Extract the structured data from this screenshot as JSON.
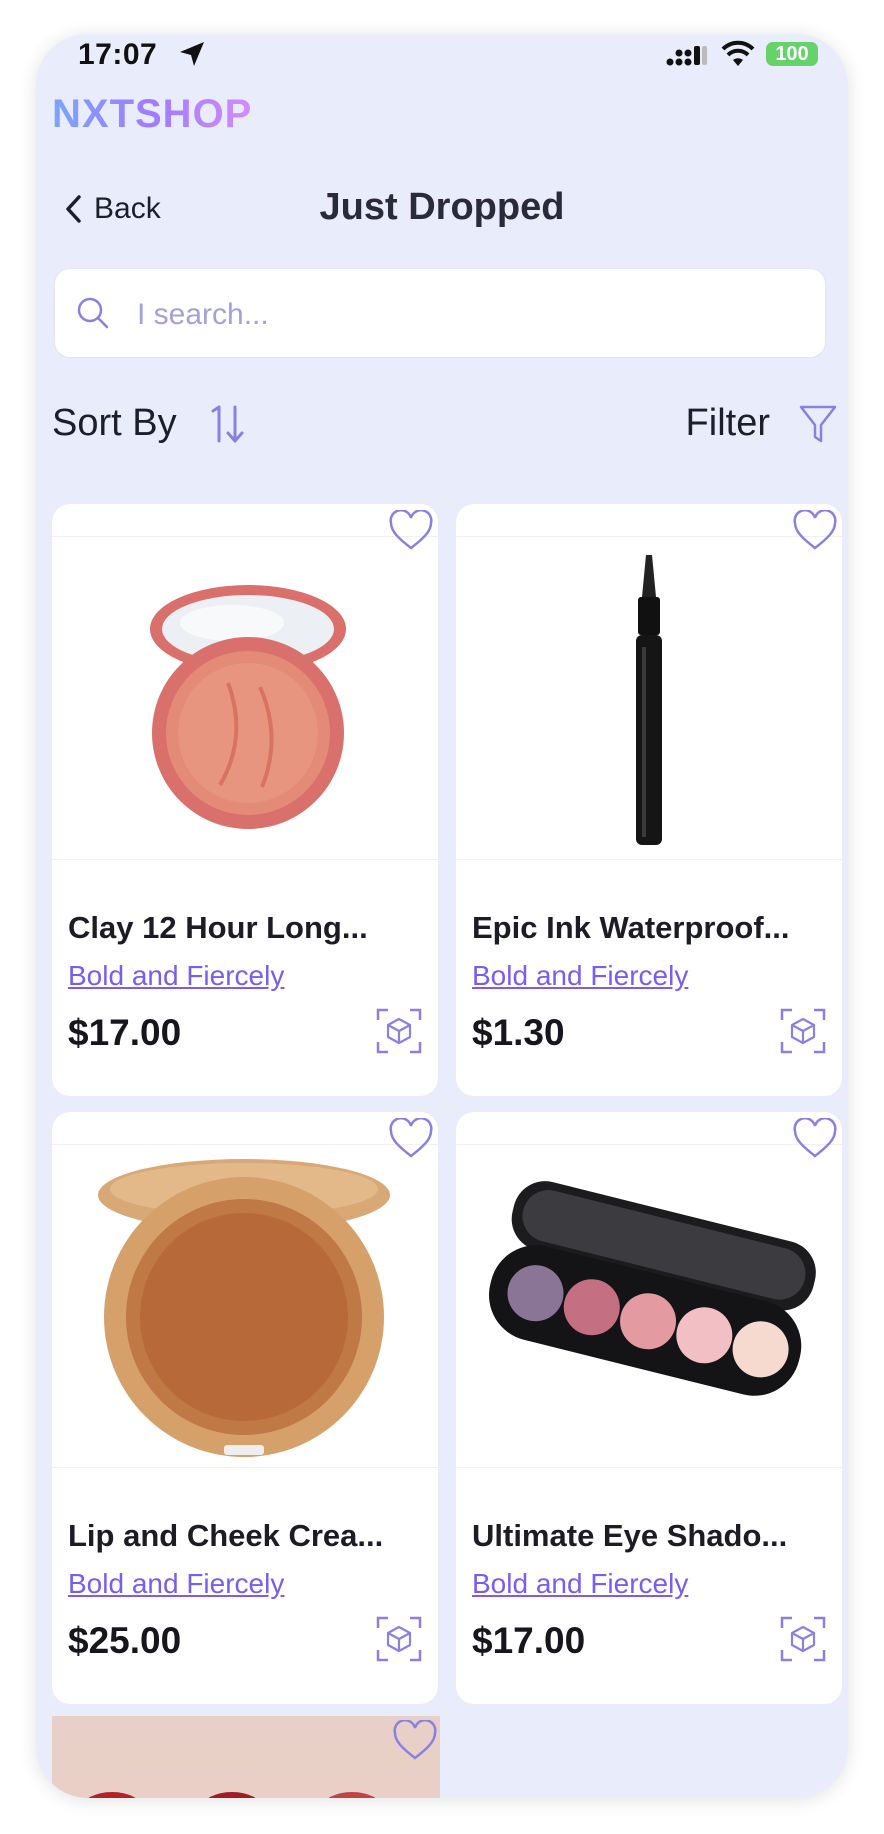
{
  "status": {
    "time": "17:07",
    "battery": "100"
  },
  "brand": {
    "logo": "NXTSHOP"
  },
  "header": {
    "back_label": "Back",
    "title": "Just Dropped"
  },
  "search": {
    "placeholder": "I search..."
  },
  "controls": {
    "sort_label": "Sort By",
    "filter_label": "Filter"
  },
  "products": [
    {
      "name": "Clay 12 Hour Long...",
      "brand": "Bold and Fiercely",
      "price": "$17.00",
      "image": "blush-compact"
    },
    {
      "name": "Epic Ink Waterproof...",
      "brand": "Bold and Fiercely",
      "price": "$1.30",
      "image": "eyeliner-pen"
    },
    {
      "name": "Lip and Cheek Crea...",
      "brand": "Bold and Fiercely",
      "price": "$25.00",
      "image": "bronze-compact"
    },
    {
      "name": "Ultimate Eye Shado...",
      "brand": "Bold and Fiercely",
      "price": "$17.00",
      "image": "eyeshadow-palette"
    }
  ],
  "colors": {
    "background": "#e9ecfb",
    "accent": "#7a5cf0",
    "icon": "#8a80e0"
  }
}
